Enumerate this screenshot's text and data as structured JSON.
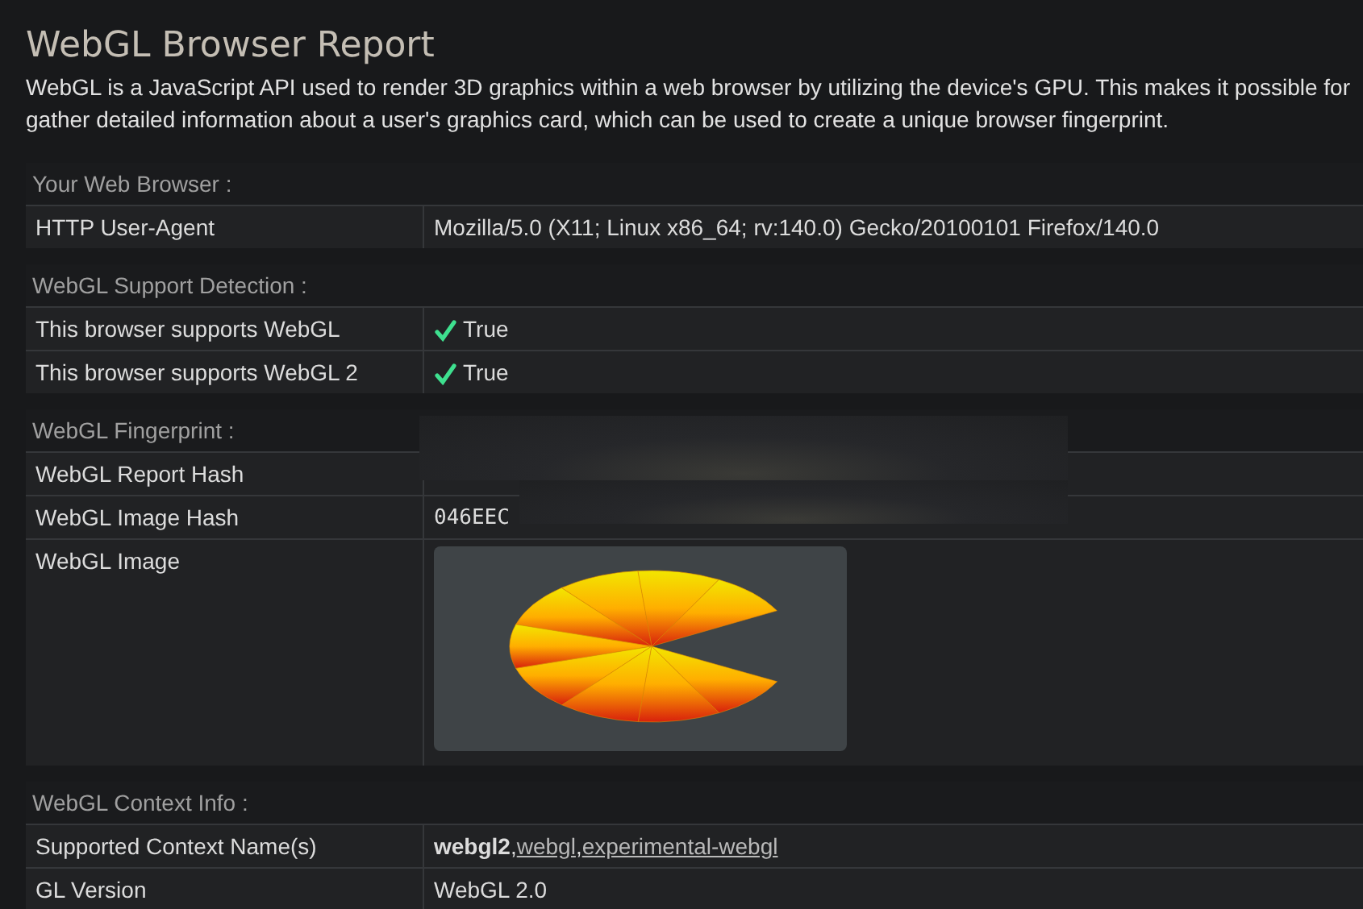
{
  "title": "WebGL Browser Report",
  "intro": [
    "WebGL is a JavaScript API used to render 3D graphics within a web browser by utilizing the device's GPU. This makes it possible for",
    "gather detailed information about a user's graphics card, which can be used to create a unique browser fingerprint."
  ],
  "sections": [
    {
      "heading": "Your Web Browser :",
      "rows": [
        {
          "label": "HTTP User-Agent",
          "kind": "text",
          "value": "Mozilla/5.0 (X11; Linux x86_64; rv:140.0) Gecko/20100101 Firefox/140.0"
        }
      ]
    },
    {
      "heading": "WebGL Support Detection :",
      "rows": [
        {
          "label": "This browser supports WebGL",
          "kind": "check",
          "checked": true,
          "value": "True"
        },
        {
          "label": "This browser supports WebGL 2",
          "kind": "check",
          "checked": true,
          "value": "True"
        }
      ]
    },
    {
      "heading": "WebGL Fingerprint :",
      "redacted": true,
      "rows": [
        {
          "label": "WebGL Report Hash",
          "kind": "text"
        },
        {
          "label": "WebGL Image Hash",
          "kind": "mono",
          "value": "046EEC"
        },
        {
          "label": "WebGL Image"
        }
      ]
    },
    {
      "heading": "WebGL Context Info :",
      "rows": [
        {
          "label": "Supported Context Name(s)",
          "kind": "contexts",
          "separator": ",",
          "items": [
            {
              "text": "webgl2",
              "kind": "bold"
            },
            {
              "text": "webgl",
              "kind": "link"
            },
            {
              "text": "experimental-webgl",
              "kind": "link"
            }
          ]
        },
        {
          "label": "GL Version",
          "kind": "text",
          "value": "WebGL 2.0"
        }
      ]
    }
  ]
}
